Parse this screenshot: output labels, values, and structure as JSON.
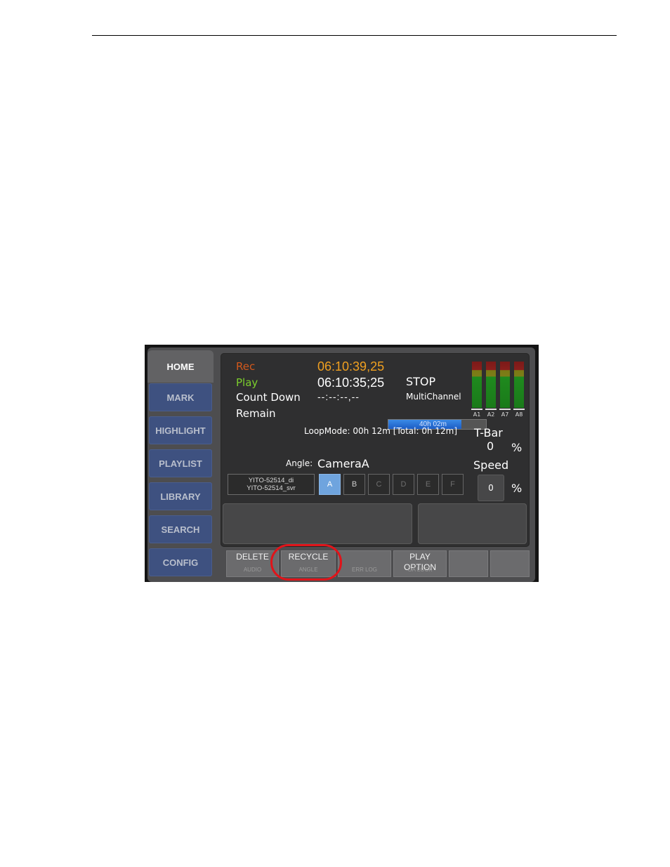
{
  "sidebar": {
    "tabs": [
      {
        "label": "HOME",
        "active": true
      },
      {
        "label": "MARK"
      },
      {
        "label": "HIGHLIGHT"
      },
      {
        "label": "PLAYLIST"
      },
      {
        "label": "LIBRARY"
      },
      {
        "label": "SEARCH"
      },
      {
        "label": "CONFIG"
      }
    ]
  },
  "status": {
    "rec_label": "Rec",
    "rec_timecode": "06:10:39,25",
    "play_label": "Play",
    "play_timecode": "06:10:35;25",
    "countdown_label": "Count Down",
    "countdown_timecode": "--:--:--,--",
    "remain_label": "Remain",
    "remain_value": "40h 02m",
    "remain_fraction": 0.75,
    "transport_state": "STOP",
    "channel_mode": "MultiChannel",
    "loopmode_text": "LoopMode: 00h 12m [Total: 0h 12m]"
  },
  "colors": {
    "rec": "#d2581c",
    "rec_timecode": "#f0a020",
    "play": "#7ccf2c",
    "tab_blue": "#3e5180",
    "angle_selected": "#6fa4de",
    "highlight_ring": "#e0141a"
  },
  "audio_meters": {
    "labels": [
      "A1",
      "A2",
      "A7",
      "A8"
    ]
  },
  "tbar": {
    "label": "T-Bar",
    "value": "0",
    "unit": "%"
  },
  "speed": {
    "label": "Speed",
    "value": "0",
    "unit": "%"
  },
  "angle": {
    "label": "Angle:",
    "value": "CameraA",
    "clip_line1": "YITO-52514_di",
    "clip_line2": "YITO-52514_svr",
    "buttons": [
      {
        "label": "A",
        "selected": true
      },
      {
        "label": "B"
      },
      {
        "label": "C",
        "disabled": true
      },
      {
        "label": "D",
        "disabled": true
      },
      {
        "label": "E",
        "disabled": true
      },
      {
        "label": "F",
        "disabled": true
      }
    ]
  },
  "function_buttons": [
    {
      "top": "DELETE",
      "bottom": "AUDIO"
    },
    {
      "top": "RECYCLE",
      "bottom": "ANGLE",
      "highlighted": true
    },
    {
      "top": "",
      "bottom": "ERR LOG"
    },
    {
      "top": "PLAY OPTION",
      "bottom": "OA LOCK"
    },
    {
      "top": "",
      "bottom": ""
    },
    {
      "top": "",
      "bottom": ""
    }
  ]
}
